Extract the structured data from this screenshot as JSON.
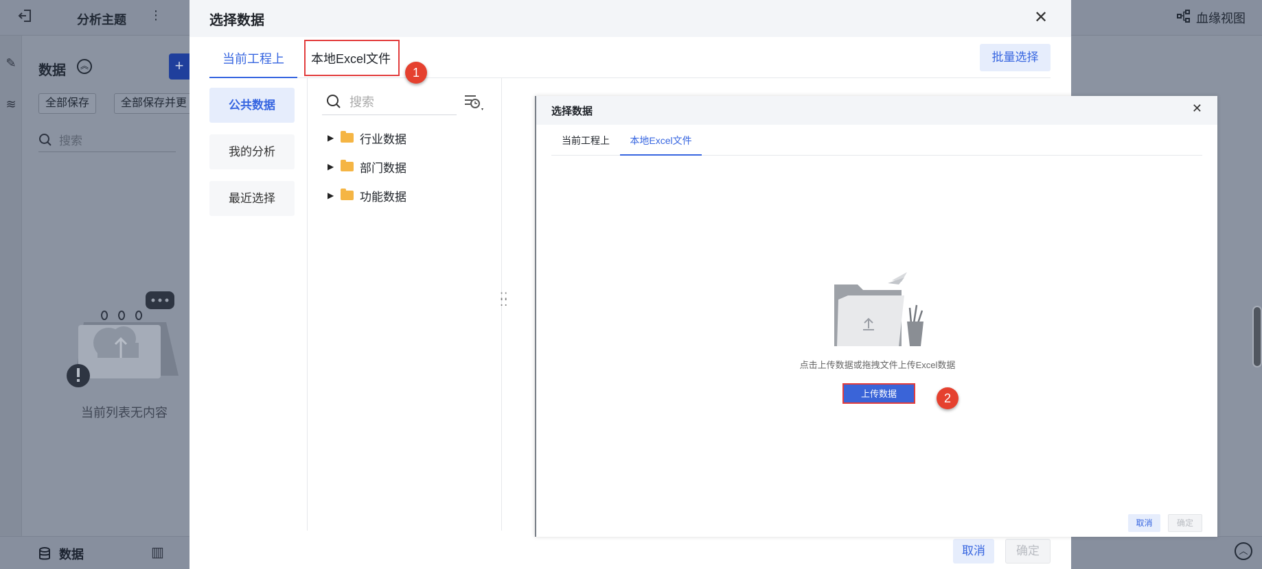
{
  "background": {
    "title": "分析主题",
    "lineage_label": "血缘视图",
    "panel_title": "数据",
    "save_all": "全部保存",
    "save_all_update": "全部保存并更",
    "search_placeholder": "搜索",
    "empty_text": "当前列表无内容",
    "bottom_tab": "数据"
  },
  "dialog": {
    "title": "选择数据",
    "tabs": [
      "当前工程上",
      "本地Excel文件"
    ],
    "batch_select": "批量选择",
    "nav_items": [
      "公共数据",
      "我的分析",
      "最近选择"
    ],
    "search_placeholder": "搜索",
    "tree_nodes": [
      "行业数据",
      "部门数据",
      "功能数据"
    ],
    "cancel": "取消",
    "ok": "确定"
  },
  "inset_dialog": {
    "title": "选择数据",
    "tabs": [
      "当前工程上",
      "本地Excel文件"
    ],
    "hint": "点击上传数据或拖拽文件上传Excel数据",
    "upload_button": "上传数据",
    "cancel": "取消",
    "ok": "确定"
  },
  "annotations": {
    "badge_1": "1",
    "badge_2": "2"
  },
  "colors": {
    "accent": "#3665e0",
    "highlight_red": "#e23c3c",
    "badge_red": "#e5412f",
    "folder": "#f5b544"
  }
}
